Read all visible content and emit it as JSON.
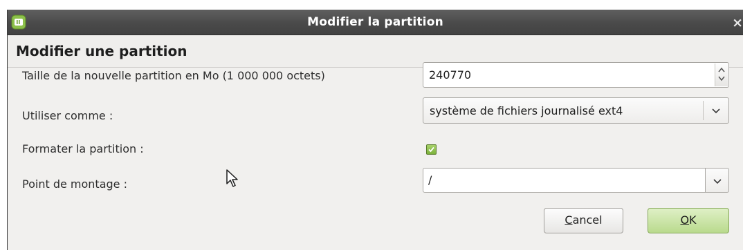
{
  "window": {
    "title": "Modifier la partition",
    "close_glyph": "×"
  },
  "dialog": {
    "heading": "Modifier une partition"
  },
  "fields": {
    "size_label": "Taille de la nouvelle partition en Mo (1 000 000 octets)",
    "size_value": "240770",
    "use_as_label": "Utiliser comme :",
    "use_as_value": "système de fichiers journalisé ext4",
    "format_label": "Formater la partition :",
    "format_checked": true,
    "mount_label": "Point de montage :",
    "mount_value": "/"
  },
  "buttons": {
    "cancel_mnemonic": "C",
    "cancel_rest": "ancel",
    "ok_mnemonic": "O",
    "ok_rest": "K"
  },
  "icons": {
    "app": "linux-mint-logo-icon",
    "close": "close-icon",
    "spin_up": "spin-up-arrow-icon",
    "spin_down": "spin-down-arrow-icon",
    "dropdown": "chevron-down-icon",
    "check": "checkmark-icon",
    "cursor": "mouse-pointer-icon"
  },
  "colors": {
    "titlebar": "#4a4a4a",
    "accent_green": "#7bb13b",
    "ok_button": "#b9da8d"
  }
}
